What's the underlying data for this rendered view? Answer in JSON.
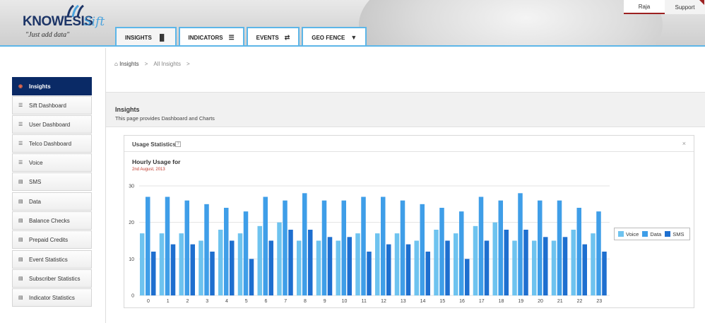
{
  "header": {
    "logo_main": "KNOWESIS",
    "logo_sift": "Sift",
    "logo_tagline": "\"Just add data\"",
    "tabs": [
      {
        "label": "INSIGHTS",
        "icon": "signal-bars-icon",
        "glyph": "▐▌"
      },
      {
        "label": "INDICATORS",
        "icon": "list-icon",
        "glyph": "☰"
      },
      {
        "label": "EVENTS",
        "icon": "retweet-icon",
        "glyph": "⇄"
      },
      {
        "label": "GEO FENCE",
        "icon": "map-pin-icon",
        "glyph": "▼"
      }
    ],
    "user": "Raja",
    "support": "Support"
  },
  "sidebar": {
    "items": [
      {
        "label": "Insights",
        "icon": "dashboard-icon"
      },
      {
        "label": "Sift Dashboard",
        "icon": "list-icon"
      },
      {
        "label": "User Dashboard",
        "icon": "list-icon"
      },
      {
        "label": "Telco Dashboard",
        "icon": "list-icon"
      },
      {
        "label": "Voice",
        "icon": "list-icon"
      },
      {
        "label": "SMS",
        "icon": "chart-icon"
      },
      {
        "label": "Data",
        "icon": "chart-icon"
      },
      {
        "label": "Balance Checks",
        "icon": "chart-icon"
      },
      {
        "label": "Prepaid Credits",
        "icon": "chart-icon"
      },
      {
        "label": "Event Statistics",
        "icon": "chart-icon"
      },
      {
        "label": "Subscriber Statistics",
        "icon": "chart-icon"
      },
      {
        "label": "Indicator Statistics",
        "icon": "chart-icon"
      }
    ]
  },
  "breadcrumb": {
    "home": "Insights",
    "current": "All Insights",
    "sep": ">"
  },
  "page": {
    "title": "Insights",
    "description": "This page provides Dashboard and Charts"
  },
  "panel": {
    "title": "Usage Statistics",
    "help": "?",
    "close": "×"
  },
  "chart_data": {
    "type": "bar",
    "title": "Hourly Usage for",
    "subtitle": "2nd August, 2013",
    "categories": [
      "0",
      "1",
      "2",
      "3",
      "4",
      "5",
      "6",
      "7",
      "8",
      "9",
      "10",
      "11",
      "12",
      "13",
      "14",
      "15",
      "16",
      "17",
      "18",
      "19",
      "20",
      "21",
      "22",
      "23"
    ],
    "series": [
      {
        "name": "Voice",
        "color": "#6ec3ef",
        "values": [
          17,
          17,
          17,
          15,
          18,
          17,
          19,
          20,
          15,
          15,
          15,
          17,
          17,
          17,
          15,
          18,
          17,
          19,
          20,
          15,
          15,
          15,
          18,
          17
        ]
      },
      {
        "name": "Data",
        "color": "#3f9ee8",
        "values": [
          27,
          27,
          26,
          25,
          24,
          23,
          27,
          26,
          28,
          26,
          26,
          27,
          27,
          26,
          25,
          24,
          23,
          27,
          26,
          28,
          26,
          26,
          24,
          23
        ]
      },
      {
        "name": "SMS",
        "color": "#1e6fcf",
        "values": [
          12,
          14,
          14,
          12,
          15,
          10,
          15,
          18,
          18,
          16,
          16,
          12,
          14,
          14,
          12,
          15,
          10,
          15,
          18,
          18,
          16,
          16,
          14,
          12
        ]
      }
    ],
    "ylim": [
      0,
      30
    ],
    "yticks": [
      0,
      10,
      20,
      30
    ],
    "grid": true,
    "legend": "right"
  }
}
